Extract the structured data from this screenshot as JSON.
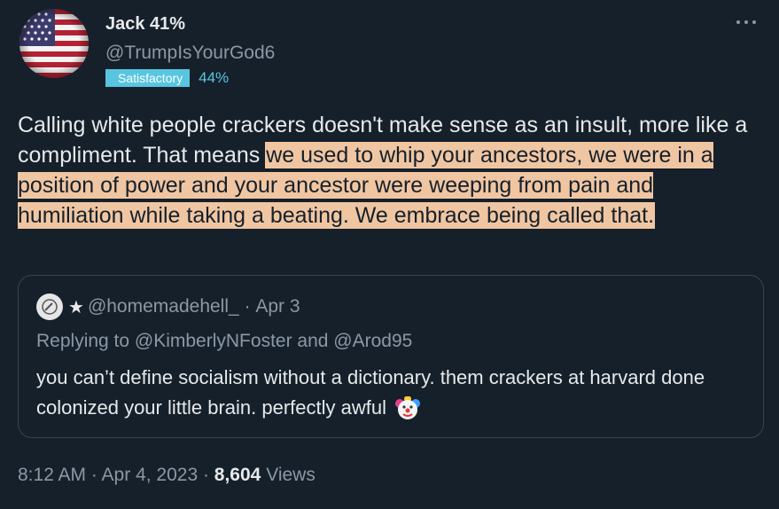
{
  "author": {
    "name": "Jack 41%",
    "handle": "@TrumpIsYourGod6",
    "badge_label": "Satisfactory",
    "badge_pct": "44%"
  },
  "tweet": {
    "text_plain": "Calling white people crackers doesn't make sense as an insult, more like a compliment. That means ",
    "text_highlight": "we used to whip your ancestors, we were in a position of power and your ancestor were weeping from pain and humiliation while taking a beating. We embrace being called that."
  },
  "quote": {
    "handle": "@homemadehell_",
    "date": "Apr 3",
    "replying": "Replying to @KimberlyNFoster and @Arod95",
    "text": "you can’t define socialism without a dictionary. them crackers at harvard done colonized your little brain. perfectly awful"
  },
  "footer": {
    "time": "8:12 AM · Apr 4, 2023 · ",
    "views_count": "8,604",
    "views_label": "Views"
  },
  "icons": [
    "more-icon",
    "clown-emoji-icon",
    "star-icon"
  ],
  "colors": {
    "background": "#15202b",
    "highlight": "#f0c6a2",
    "badge": "#58c6e0"
  }
}
